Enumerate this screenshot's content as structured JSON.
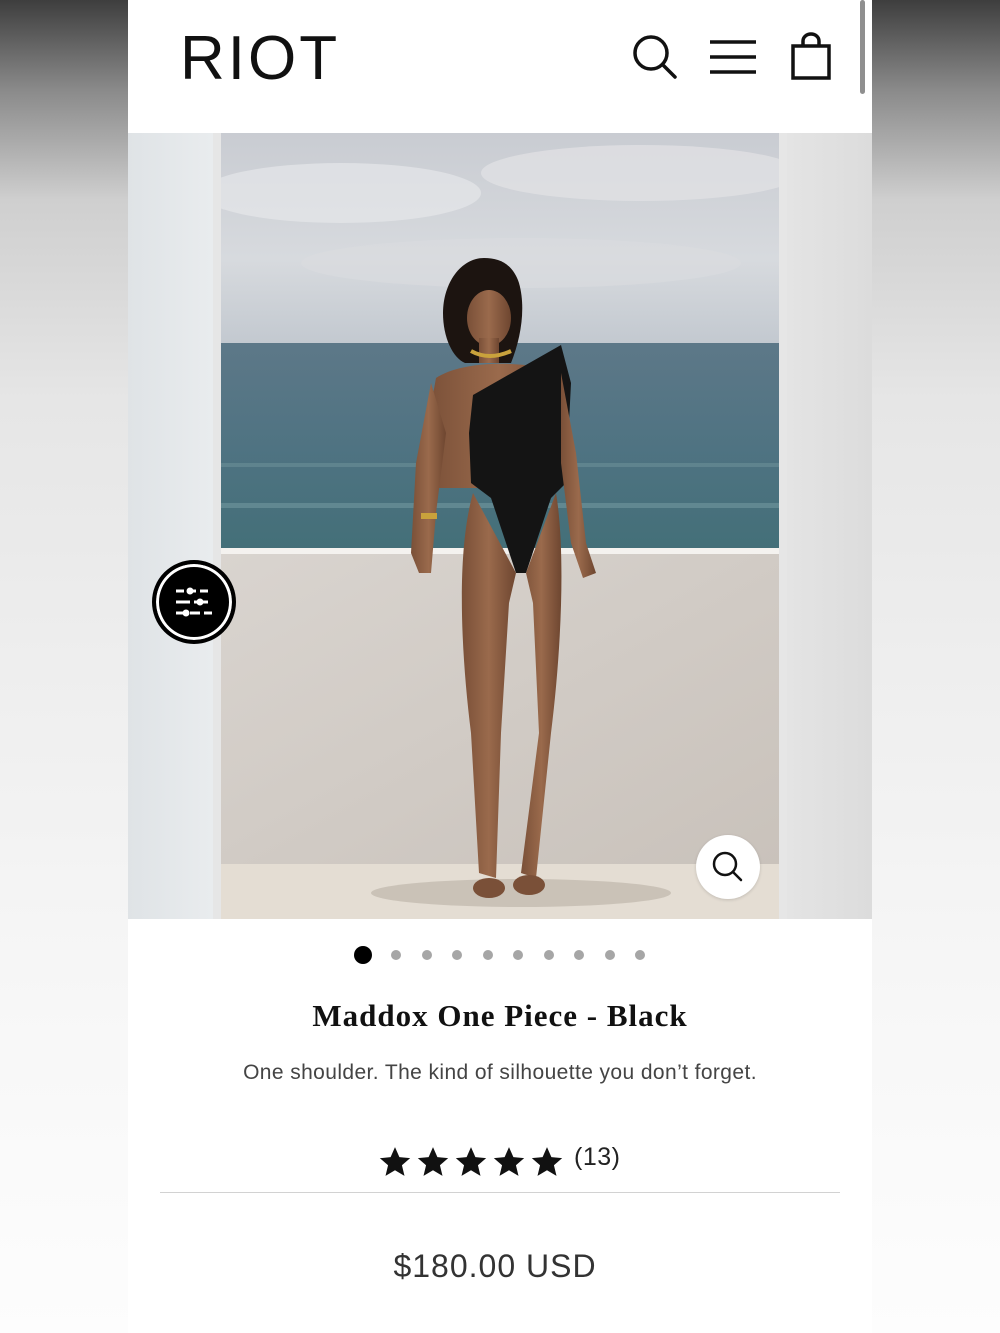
{
  "header": {
    "logo_text": "RIOT",
    "icons": [
      "search-icon",
      "menu-icon",
      "cart-icon"
    ]
  },
  "gallery": {
    "dots_count": 10,
    "active_dot": 1,
    "filter_icon": "sliders-icon",
    "zoom_icon": "magnifier-icon"
  },
  "product": {
    "title": "Maddox One Piece - Black",
    "subtitle": "One shoulder. The kind of silhouette you don’t forget.",
    "rating_stars": 5,
    "rating_count": "(13)",
    "price": "$180.00 USD"
  },
  "colors": {
    "text": "#111111",
    "accent": "#000000",
    "dot_inactive": "#a6a6a6"
  }
}
